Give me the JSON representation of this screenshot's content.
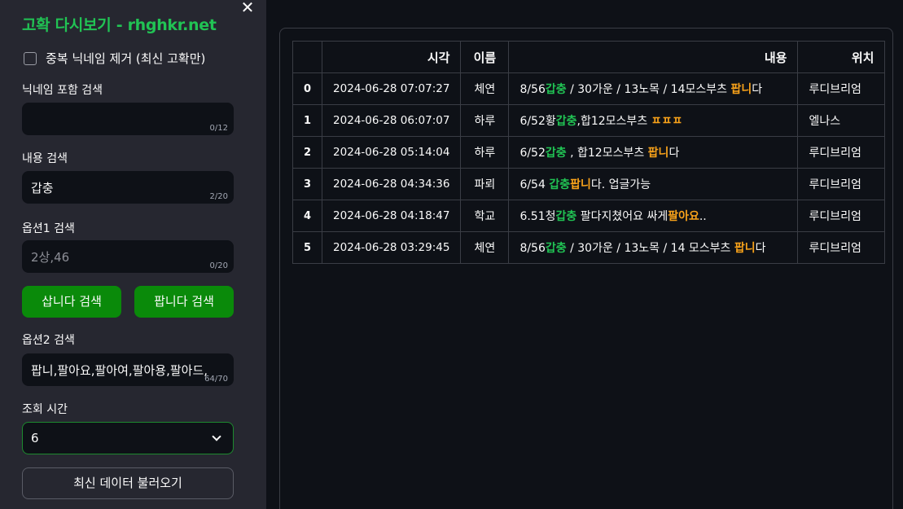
{
  "sidebar": {
    "title": "고확 다시보기 - rhghkr.net",
    "close_glyph": "✕",
    "dedupe_label": "중복 닉네임 제거 (최신 고확만)",
    "nickname": {
      "label": "닉네임 포함 검색",
      "value": "",
      "counter": "0/12"
    },
    "content": {
      "label": "내용 검색",
      "value": "갑충",
      "counter": "2/20"
    },
    "option1": {
      "label": "옵션1 검색",
      "placeholder": "2상,46",
      "counter": "0/20"
    },
    "buy_button": "삽니다 검색",
    "sell_button": "팝니다 검색",
    "option2": {
      "label": "옵션2 검색",
      "value": "팝니,팔아요,팔아여,팔아용,팔아드,",
      "counter": "64/70"
    },
    "period": {
      "label": "조회 시간",
      "value": "6"
    },
    "refresh_button": "최신 데이터 불러오기"
  },
  "table": {
    "headers": {
      "index": "",
      "time": "시각",
      "name": "이름",
      "content": "내용",
      "location": "위치"
    },
    "rows": [
      {
        "index": "0",
        "time": "2024-06-28 07:07:27",
        "name": "체연",
        "content": [
          [
            "8/56",
            ""
          ],
          [
            "갑충",
            "g"
          ],
          [
            " / 30가운 / 13노목 / 14모스부츠 ",
            ""
          ],
          [
            "팝니",
            "o"
          ],
          [
            "다",
            ""
          ]
        ],
        "location": "루디브리엄"
      },
      {
        "index": "1",
        "time": "2024-06-28 06:07:07",
        "name": "하루",
        "content": [
          [
            "6/52황",
            ""
          ],
          [
            "갑충",
            "g"
          ],
          [
            ",합12모스부츠 ",
            ""
          ],
          [
            "ㅍㅍㅍ",
            "o"
          ]
        ],
        "location": "엘나스"
      },
      {
        "index": "2",
        "time": "2024-06-28 05:14:04",
        "name": "하루",
        "content": [
          [
            "6/52",
            ""
          ],
          [
            "갑충",
            "g"
          ],
          [
            " , 합12모스부츠 ",
            ""
          ],
          [
            "팝니",
            "o"
          ],
          [
            "다",
            ""
          ]
        ],
        "location": "루디브리엄"
      },
      {
        "index": "3",
        "time": "2024-06-28 04:34:36",
        "name": "파뢰",
        "content": [
          [
            "6/54 ",
            ""
          ],
          [
            "갑충",
            "g"
          ],
          [
            "팝니",
            "o"
          ],
          [
            "다. 업글가능",
            ""
          ]
        ],
        "location": "루디브리엄"
      },
      {
        "index": "4",
        "time": "2024-06-28 04:18:47",
        "name": "학교",
        "content": [
          [
            "6.51청",
            ""
          ],
          [
            "갑충",
            "g"
          ],
          [
            " 팔다지쳤어요 싸게",
            ""
          ],
          [
            "팔아요",
            "o"
          ],
          [
            "..",
            ""
          ]
        ],
        "location": "루디브리엄"
      },
      {
        "index": "5",
        "time": "2024-06-28 03:29:45",
        "name": "체연",
        "content": [
          [
            "8/56",
            ""
          ],
          [
            "갑충",
            "g"
          ],
          [
            " / 30가운 / 13노목 / 14 모스부츠 ",
            ""
          ],
          [
            "팝니",
            "o"
          ],
          [
            "다",
            ""
          ]
        ],
        "location": "루디브리엄"
      }
    ]
  },
  "colors": {
    "accent_green": "#21c354",
    "highlight_orange": "#f8a21a",
    "button_green": "#0a8a0a",
    "sidebar_bg": "#262730",
    "main_bg": "#0e1117"
  }
}
